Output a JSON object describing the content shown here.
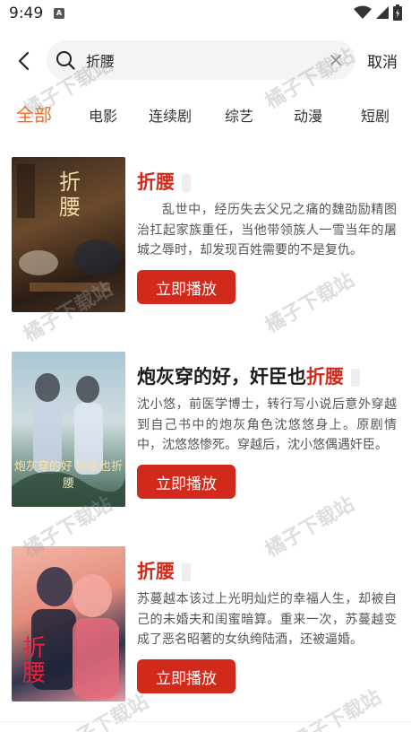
{
  "status_bar": {
    "time": "9:49",
    "notification_badge": "A"
  },
  "search": {
    "value": "折腰",
    "cancel_label": "取消"
  },
  "tabs": [
    {
      "label": "全部",
      "active": true
    },
    {
      "label": "电影",
      "active": false
    },
    {
      "label": "连续剧",
      "active": false
    },
    {
      "label": "综艺",
      "active": false
    },
    {
      "label": "动漫",
      "active": false
    },
    {
      "label": "短剧",
      "active": false
    }
  ],
  "results": [
    {
      "title_prefix": "",
      "title_highlight": "折腰",
      "cover_text": "折腰",
      "description": "乱世中，经历失去父兄之痛的魏劭励精图治扛起家族重任，当他带领族人一雪当年的屠城之辱时，却发现百姓需要的不是复仇。",
      "play_label": "立即播放"
    },
    {
      "title_prefix": "炮灰穿的好，奸臣也",
      "title_highlight": "折腰",
      "cover_text": "炮灰穿的好 奸臣也折腰",
      "description": "沈小悠，前医学博士，转行写小说后意外穿越到自己书中的炮灰角色沈悠悠身上。原剧情中，沈悠悠惨死。穿越后，沈小悠偶遇奸臣。",
      "play_label": "立即播放"
    },
    {
      "title_prefix": "",
      "title_highlight": "折腰",
      "cover_text": "折腰",
      "description": "苏蔓越本该过上光明灿烂的幸福人生，却被自己的未婚夫和闺蜜暗算。重来一次，苏蔓越变成了恶名昭著的女纨绔陆酒，还被逼婚。",
      "play_label": "立即播放"
    }
  ],
  "watermark_text": "橘子下载站",
  "colors": {
    "accent_orange": "#f56a1f",
    "highlight_red": "#d12a1c",
    "button_red": "#d12a1c"
  }
}
